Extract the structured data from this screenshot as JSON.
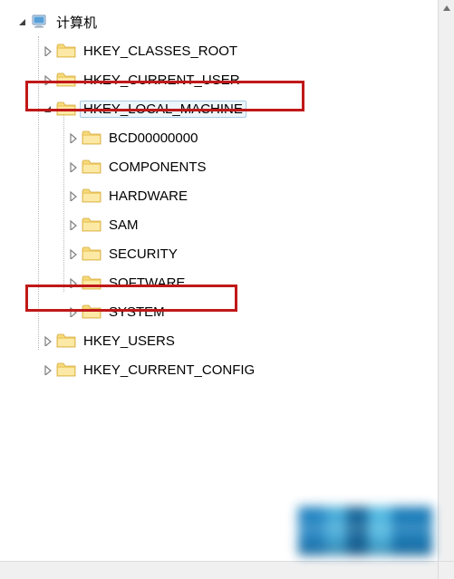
{
  "root": {
    "label": "计算机",
    "expanded": true
  },
  "hives": [
    {
      "label": "HKEY_CLASSES_ROOT"
    },
    {
      "label": "HKEY_CURRENT_USER"
    },
    {
      "label": "HKEY_LOCAL_MACHINE",
      "expanded": true,
      "selected": true,
      "highlighted": true
    },
    {
      "label": "HKEY_USERS"
    },
    {
      "label": "HKEY_CURRENT_CONFIG"
    }
  ],
  "hklm_children": [
    {
      "label": "BCD00000000"
    },
    {
      "label": "COMPONENTS"
    },
    {
      "label": "HARDWARE"
    },
    {
      "label": "SAM"
    },
    {
      "label": "SECURITY"
    },
    {
      "label": "SOFTWARE"
    },
    {
      "label": "SYSTEM",
      "highlighted": true
    }
  ],
  "icons": {
    "expanded": "expanded-arrow",
    "collapsed": "collapsed-arrow",
    "folder": "folder",
    "computer": "computer"
  }
}
